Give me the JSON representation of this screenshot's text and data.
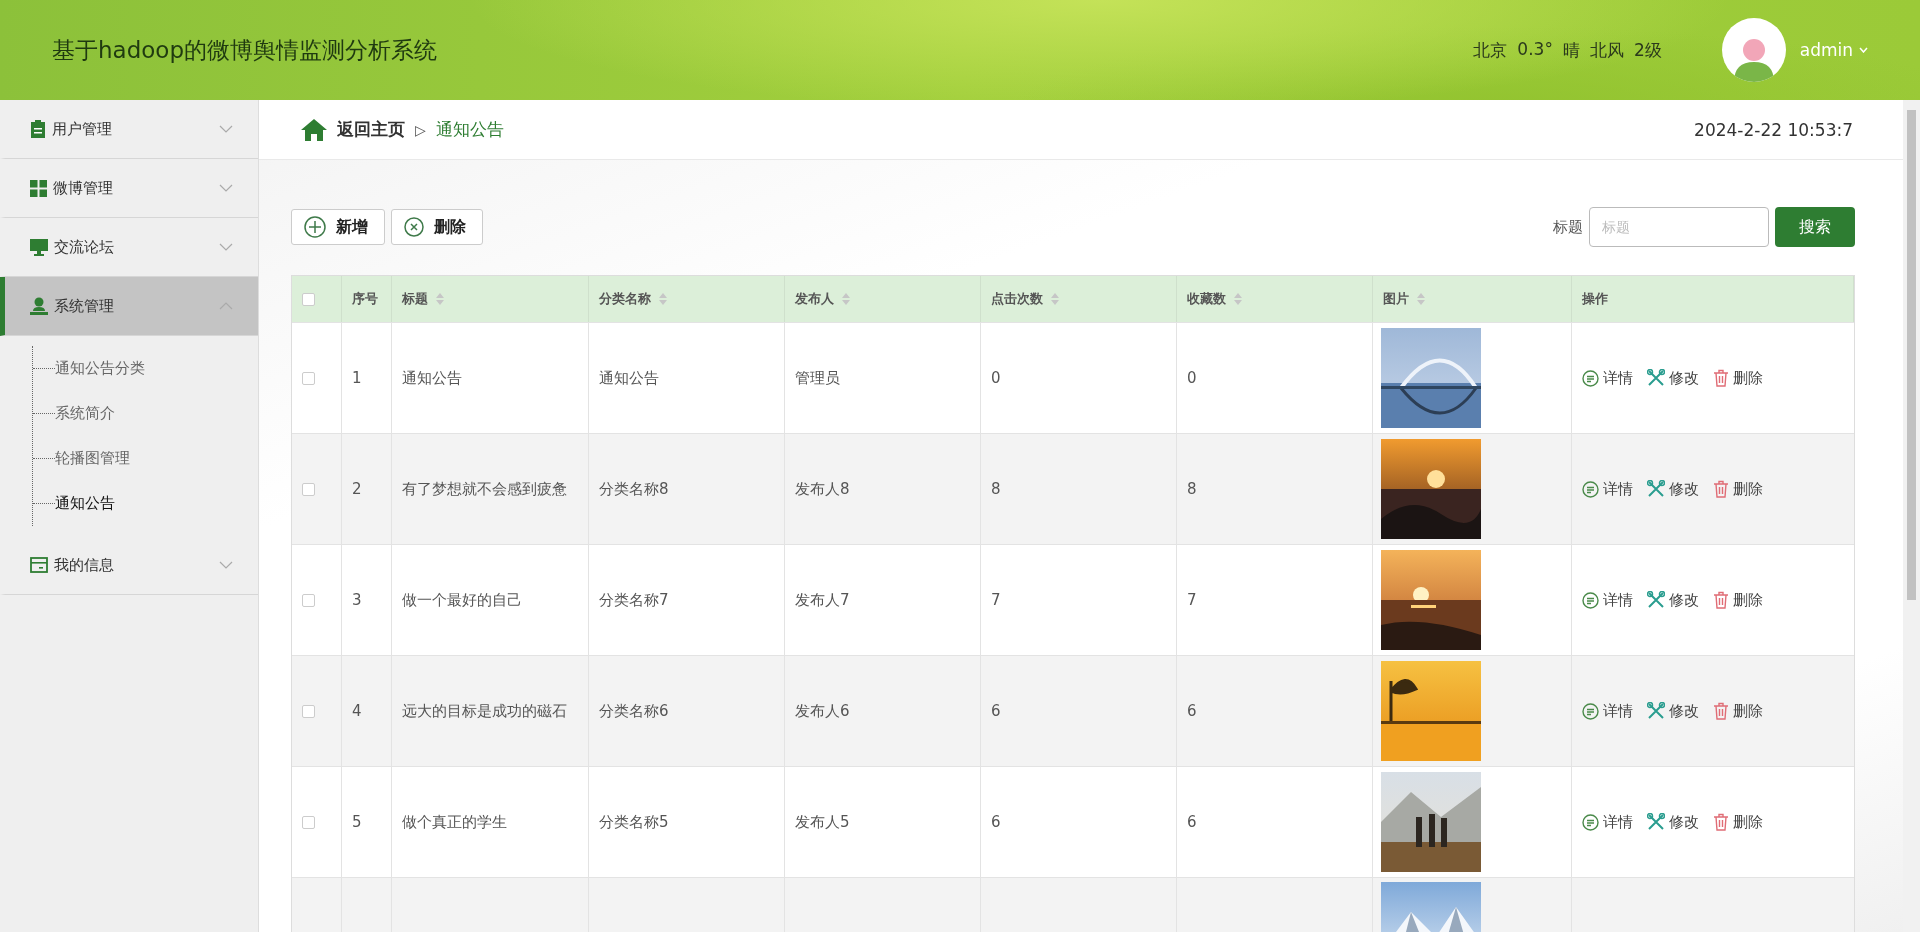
{
  "header": {
    "title": "基于hadoop的微博舆情监测分析系统",
    "weather": [
      "北京",
      "0.3°",
      "晴",
      "北风",
      "2级"
    ],
    "user": "admin"
  },
  "sidebar": {
    "items": [
      {
        "label": "用户管理",
        "expanded": false,
        "selected": false
      },
      {
        "label": "微博管理",
        "expanded": false,
        "selected": false
      },
      {
        "label": "交流论坛",
        "expanded": false,
        "selected": false
      },
      {
        "label": "系统管理",
        "expanded": true,
        "selected": true,
        "children": [
          {
            "label": "通知公告分类",
            "selected": false
          },
          {
            "label": "系统简介",
            "selected": false
          },
          {
            "label": "轮播图管理",
            "selected": false
          },
          {
            "label": "通知公告",
            "selected": true
          }
        ]
      },
      {
        "label": "我的信息",
        "expanded": false,
        "selected": false
      }
    ]
  },
  "breadcrumb": {
    "home": "返回主页",
    "separator": "▷",
    "current": "通知公告",
    "datetime": "2024-2-22 10:53:7"
  },
  "toolbar": {
    "buttons": [
      {
        "label": "新增",
        "kind": "add"
      },
      {
        "label": "删除",
        "kind": "remove"
      }
    ],
    "search_label": "标题",
    "search": {
      "placeholder": "标题"
    },
    "search_button": "搜索"
  },
  "table": {
    "header_checked": false,
    "columns": [
      {
        "label": "序号",
        "sortable": false
      },
      {
        "label": "标题",
        "sortable": true
      },
      {
        "label": "分类名称",
        "sortable": true
      },
      {
        "label": "发布人",
        "sortable": true
      },
      {
        "label": "点击次数",
        "sortable": true
      },
      {
        "label": "收藏数",
        "sortable": true
      },
      {
        "label": "图片",
        "sortable": true
      },
      {
        "label": "操作",
        "sortable": false
      }
    ],
    "rows": [
      {
        "checked": false,
        "cells": [
          "1",
          "通知公告",
          "通知公告",
          "管理员",
          "0",
          "0"
        ],
        "image": {
          "kind": "picture"
        },
        "actions": [
          "详情",
          "修改",
          "删除"
        ]
      },
      {
        "checked": false,
        "cells": [
          "2",
          "有了梦想就不会感到疲惫",
          "分类名称8",
          "发布人8",
          "8",
          "8"
        ],
        "image": {
          "kind": "picture"
        },
        "actions": [
          "详情",
          "修改",
          "删除"
        ]
      },
      {
        "checked": false,
        "cells": [
          "3",
          "做一个最好的自己",
          "分类名称7",
          "发布人7",
          "7",
          "7"
        ],
        "image": {
          "kind": "picture"
        },
        "actions": [
          "详情",
          "修改",
          "删除"
        ]
      },
      {
        "checked": false,
        "cells": [
          "4",
          "远大的目标是成功的磁石",
          "分类名称6",
          "发布人6",
          "6",
          "6"
        ],
        "image": {
          "kind": "picture"
        },
        "actions": [
          "详情",
          "修改",
          "删除"
        ]
      },
      {
        "checked": false,
        "cells": [
          "5",
          "做个真正的学生",
          "分类名称5",
          "发布人5",
          "6",
          "6"
        ],
        "image": {
          "kind": "picture"
        },
        "actions": [
          "详情",
          "修改",
          "删除"
        ]
      },
      {
        "image": {
          "kind": "picture"
        }
      }
    ]
  }
}
